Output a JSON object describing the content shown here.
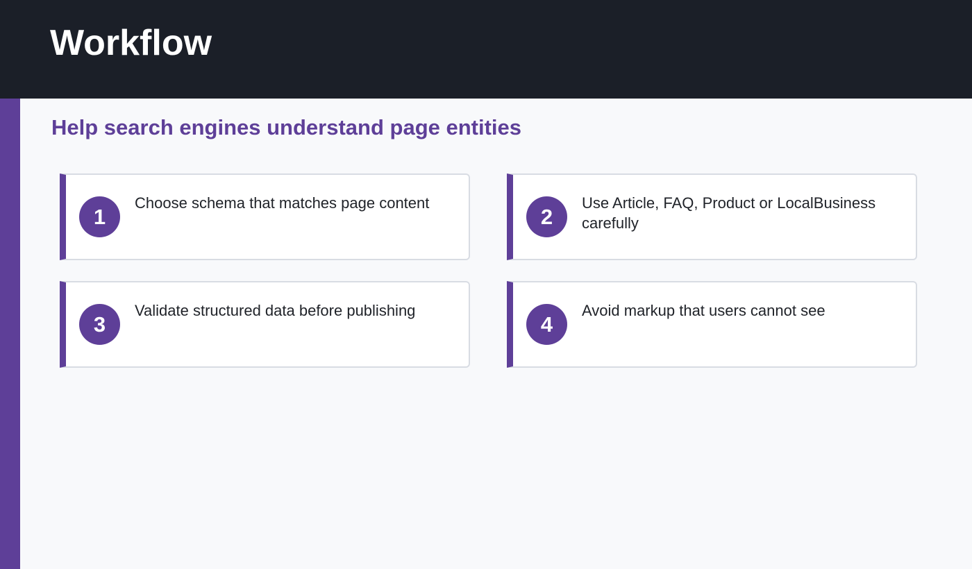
{
  "header": {
    "title": "Workflow"
  },
  "subtitle": "Help search engines understand page entities",
  "steps": [
    {
      "number": "1",
      "text": "Choose schema that matches page content"
    },
    {
      "number": "2",
      "text": "Use Article, FAQ, Product or LocalBusiness carefully"
    },
    {
      "number": "3",
      "text": "Validate structured data before publishing"
    },
    {
      "number": "4",
      "text": "Avoid markup that users cannot see"
    }
  ],
  "colors": {
    "accent": "#5e3f98",
    "header_bg": "#1b1f28",
    "page_bg": "#f8f9fb"
  }
}
